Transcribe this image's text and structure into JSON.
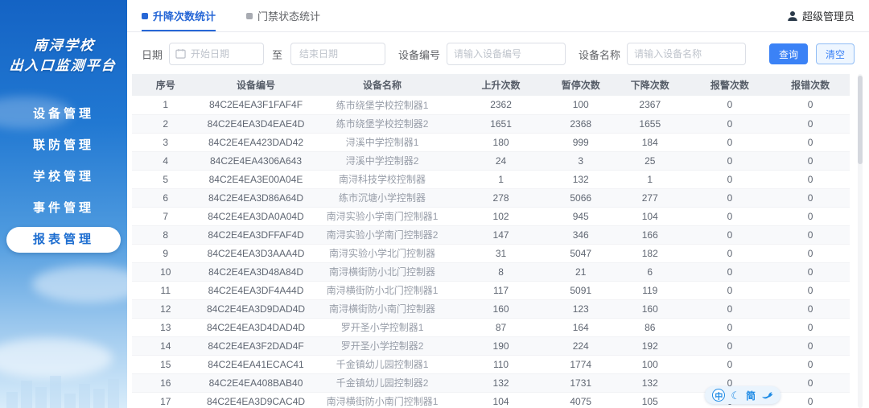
{
  "colors": {
    "sidebar_blue": "#1463c4",
    "accent": "#2767d6",
    "button_blue": "#3b82f6"
  },
  "sidebar": {
    "title_line1": "南浔学校",
    "title_line2": "出入口监测平台",
    "items": [
      {
        "label": "设备管理",
        "active": false
      },
      {
        "label": "联防管理",
        "active": false
      },
      {
        "label": "学校管理",
        "active": false
      },
      {
        "label": "事件管理",
        "active": false
      },
      {
        "label": "报表管理",
        "active": true
      }
    ]
  },
  "header": {
    "tabs": [
      {
        "label": "升降次数统计",
        "active": true
      },
      {
        "label": "门禁状态统计",
        "active": false
      }
    ],
    "user": "超级管理员",
    "user_icon": "user-icon"
  },
  "filters": {
    "date_label": "日期",
    "start_placeholder": "开始日期",
    "to_label": "至",
    "end_placeholder": "结束日期",
    "device_id_label": "设备编号",
    "device_id_placeholder": "请输入设备编号",
    "device_name_label": "设备名称",
    "device_name_placeholder": "请输入设备名称",
    "search_label": "查询",
    "clear_label": "清空",
    "calendar_icon": "calendar-icon"
  },
  "table": {
    "columns": [
      "序号",
      "设备编号",
      "设备名称",
      "上升次数",
      "暂停次数",
      "下降次数",
      "报警次数",
      "报错次数"
    ],
    "rows": [
      [
        "1",
        "84C2E4EA3F1FAF4F",
        "练市绕堡学校控制器1",
        "2362",
        "100",
        "2367",
        "0",
        "0"
      ],
      [
        "2",
        "84C2E4EA3D4EAE4D",
        "练市绕堡学校控制器2",
        "1651",
        "2368",
        "1655",
        "0",
        "0"
      ],
      [
        "3",
        "84C2E4EA423DAD42",
        "浔溪中学控制器1",
        "180",
        "999",
        "184",
        "0",
        "0"
      ],
      [
        "4",
        "84C2E4EA4306A643",
        "浔溪中学控制器2",
        "24",
        "3",
        "25",
        "0",
        "0"
      ],
      [
        "5",
        "84C2E4EA3E00A04E",
        "南浔科技学校控制器",
        "1",
        "132",
        "1",
        "0",
        "0"
      ],
      [
        "6",
        "84C2E4EA3D86A64D",
        "练市沉塘小学控制器",
        "278",
        "5066",
        "277",
        "0",
        "0"
      ],
      [
        "7",
        "84C2E4EA3DA0A04D",
        "南浔实验小学南门控制器1",
        "102",
        "945",
        "104",
        "0",
        "0"
      ],
      [
        "8",
        "84C2E4EA3DFFAF4D",
        "南浔实验小学南门控制器2",
        "147",
        "346",
        "166",
        "0",
        "0"
      ],
      [
        "9",
        "84C2E4EA3D3AAA4D",
        "南浔实验小学北门控制器",
        "31",
        "5047",
        "182",
        "0",
        "0"
      ],
      [
        "10",
        "84C2E4EA3D48A84D",
        "南浔横街防小北门控制器",
        "8",
        "21",
        "6",
        "0",
        "0"
      ],
      [
        "11",
        "84C2E4EA3DF4A44D",
        "南浔横街防小北门控制器1",
        "117",
        "5091",
        "119",
        "0",
        "0"
      ],
      [
        "12",
        "84C2E4EA3D9DAD4D",
        "南浔横街防小南门控制器",
        "160",
        "123",
        "160",
        "0",
        "0"
      ],
      [
        "13",
        "84C2E4EA3D4DAD4D",
        "罗开圣小学控制器1",
        "87",
        "164",
        "86",
        "0",
        "0"
      ],
      [
        "14",
        "84C2E4EA3F2DAD4F",
        "罗开圣小学控制器2",
        "190",
        "224",
        "192",
        "0",
        "0"
      ],
      [
        "15",
        "84C2E4EA41ECAC41",
        "千金镇幼儿园控制器1",
        "110",
        "1774",
        "100",
        "0",
        "0"
      ],
      [
        "16",
        "84C2E4EA408BAB40",
        "千金镇幼儿园控制器2",
        "132",
        "1731",
        "132",
        "0",
        "0"
      ],
      [
        "17",
        "84C2E4EA3D9CAC4D",
        "南浔横街防小南门控制器1",
        "104",
        "4075",
        "105",
        "0",
        "0"
      ]
    ]
  },
  "ime_widget": {
    "lang": "中",
    "moon_icon": "moon-icon",
    "simplified": "简",
    "dove_icon": "dove-icon"
  }
}
